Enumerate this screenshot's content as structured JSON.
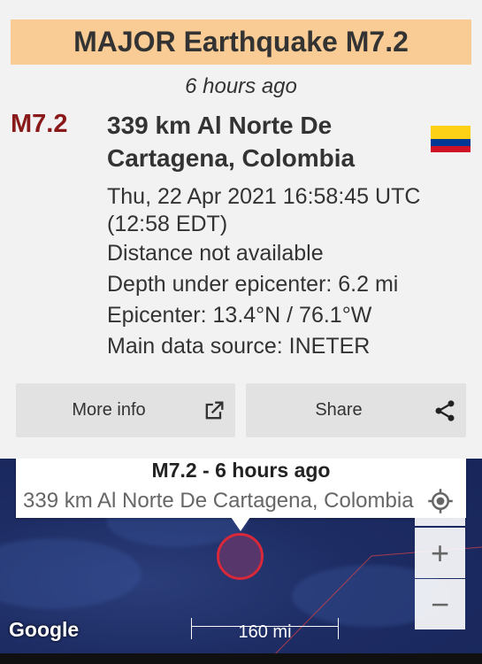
{
  "header": {
    "banner": "MAJOR Earthquake M7.2",
    "time_ago": "6 hours ago"
  },
  "event": {
    "magnitude": "M7.2",
    "place": "339 km Al Norte De Cartagena, Colombia",
    "flag_icon": "colombia-flag-icon",
    "datetime": "Thu, 22 Apr 2021 16:58:45 UTC (12:58 EDT)",
    "distance": "Distance not available",
    "depth": "Depth under epicenter: 6.2 mi",
    "epicenter": "Epicenter: 13.4°N / 76.1°W",
    "source": "Main data source: INETER"
  },
  "actions": {
    "more_info": "More info",
    "share": "Share"
  },
  "map": {
    "popup_title": "M7.2  -  6 hours ago",
    "popup_subtitle": "339 km Al Norte De Cartagena, Colombia",
    "scale_label": "160 mi",
    "attribution": "Google",
    "zoom_in": "+",
    "zoom_out": "−"
  },
  "colors": {
    "banner": "#f8cc94",
    "magnitude": "#8a1a1a",
    "quake_fill": "#56366b",
    "quake_stroke": "#d8283a"
  }
}
